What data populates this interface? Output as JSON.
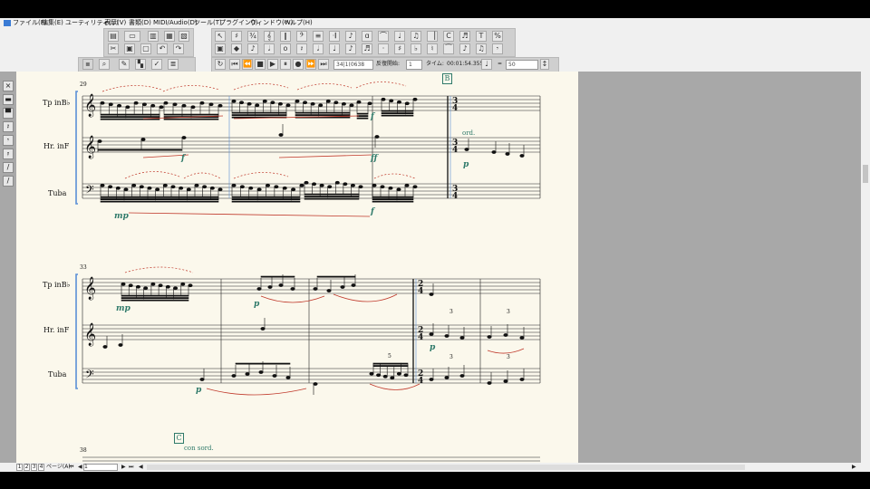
{
  "menu": {
    "items": [
      "ファイル(F)",
      "編集(E)",
      "ユーティリティ(U)",
      "表示(V)",
      "書類(D)",
      "MIDI/Audio(D)",
      "ツール(T)",
      "プラグイン(I)",
      "ウィンドウ(W)",
      "ヘルプ(H)"
    ]
  },
  "playback": {
    "position": "34|1(0638",
    "repeat_label": "反復開始:",
    "repeat_value": "1",
    "time_label": "タイム:",
    "time_value": "00:01:54.355",
    "eq": "=",
    "tempo": "50"
  },
  "score": {
    "systems": [
      {
        "measure_number": "29",
        "staves": [
          "Tp inB♭",
          "Hr. inF",
          "Tuba"
        ],
        "rehearsal": "B"
      },
      {
        "measure_number": "33",
        "staves": [
          "Tp inB♭",
          "Hr. inF",
          "Tuba"
        ]
      },
      {
        "measure_number": "38",
        "rehearsal": "C",
        "text": "con sord."
      }
    ],
    "dynamics": [
      "f",
      "f",
      "f",
      "ff",
      "p",
      "mp",
      "f",
      "mp",
      "p",
      "p",
      "p"
    ],
    "text_ord": "ord.",
    "tuplets": [
      "3",
      "3",
      "3",
      "3",
      "5"
    ],
    "time_sig_1": [
      "3",
      "4"
    ],
    "time_sig_2": [
      "2",
      "4"
    ]
  },
  "status": {
    "pages": [
      "1",
      "2",
      "3",
      "4"
    ],
    "page_label": "ページ(A):",
    "page_value": "1"
  }
}
